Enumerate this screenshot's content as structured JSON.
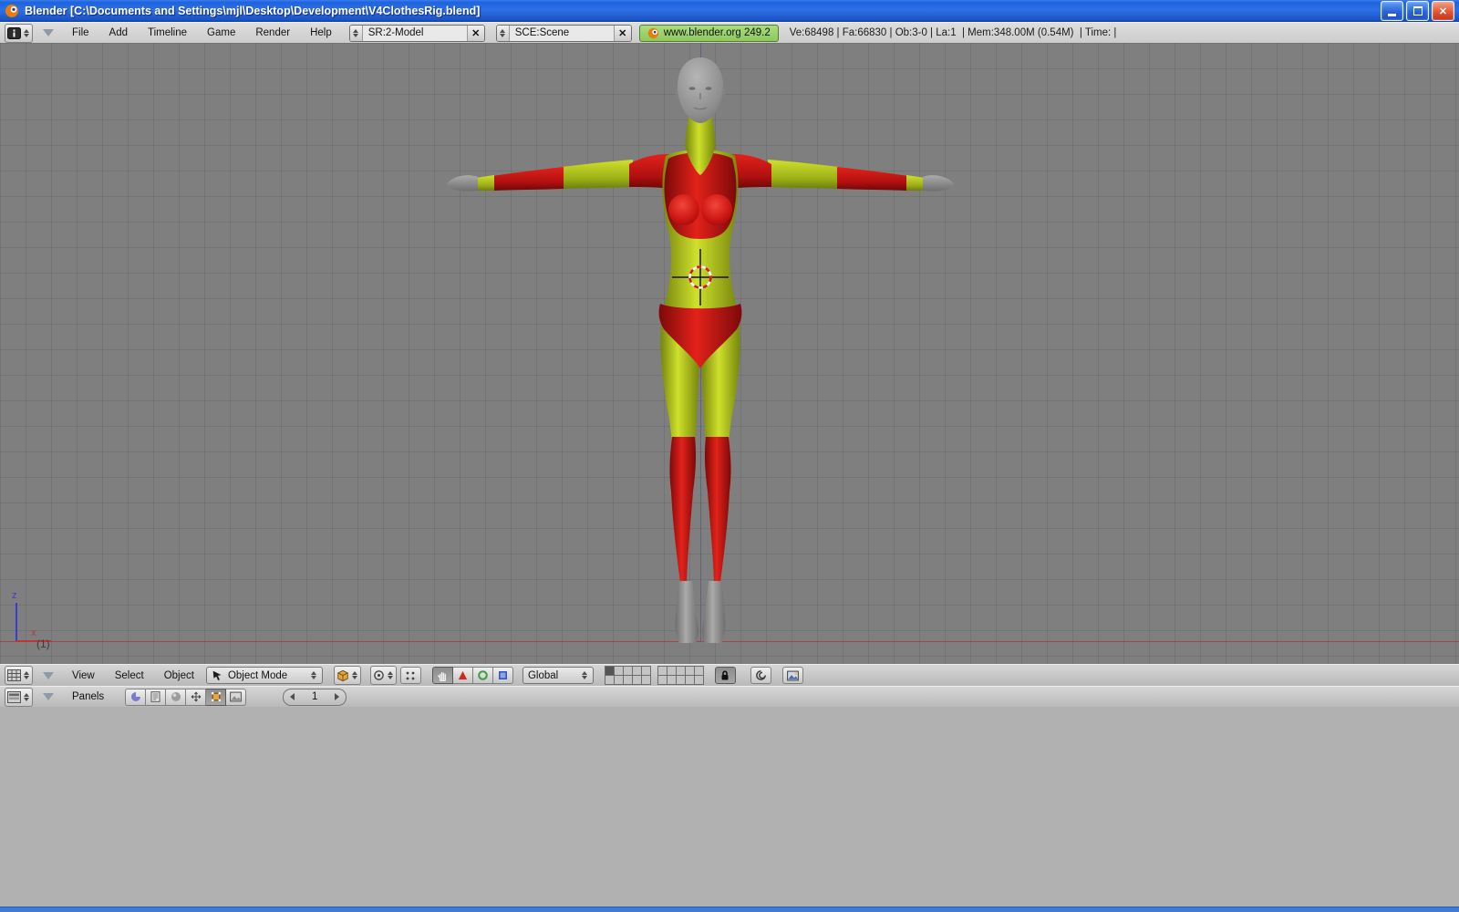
{
  "title_bar": {
    "title": "Blender [C:\\Documents and Settings\\mjl\\Desktop\\Development\\V4ClothesRig.blend]"
  },
  "icons": {
    "close_x": "✕"
  },
  "main_header": {
    "menus": [
      "File",
      "Add",
      "Timeline",
      "Game",
      "Render",
      "Help"
    ],
    "screen_combo": {
      "value": "SR:2-Model"
    },
    "scene_combo": {
      "value": "SCE:Scene"
    },
    "version_button": "www.blender.org 249.2",
    "stats": "Ve:68498 | Fa:66830 | Ob:3-0 | La:1  | Mem:348.00M (0.54M)  | Time: |"
  },
  "viewport": {
    "axis_x": "x",
    "axis_z": "z",
    "layer_label": "(1)"
  },
  "view3d_header": {
    "menus": [
      "View",
      "Select",
      "Object"
    ],
    "mode": "Object Mode",
    "orientation": "Global"
  },
  "buttons_header": {
    "panels_label": "Panels",
    "frame_value": "1"
  },
  "colors": {
    "xp_blue": "#2a63d8",
    "version_green": "#9bd36a",
    "viewport_gray": "#7f7f7f",
    "model_red": "#cc1612",
    "model_green": "#b5c920",
    "skin_gray": "#969696"
  }
}
